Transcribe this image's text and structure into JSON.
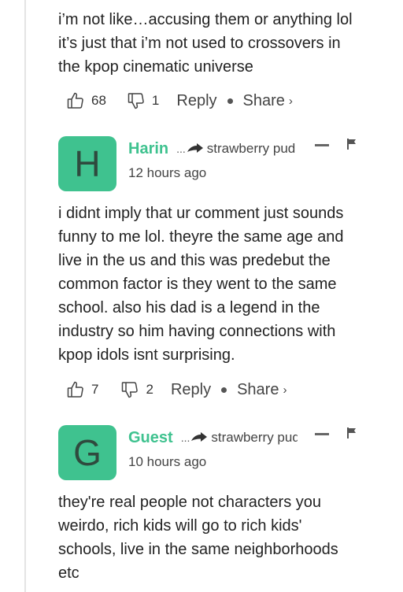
{
  "top_comment": {
    "body": [
      "i’m not like…accusing them or anything lol",
      "it’s just that i’m not used to crossovers in",
      "the kpop cinematic universe"
    ],
    "upvotes": "68",
    "downvotes": "1",
    "reply_label": "Reply",
    "share_label": "Share",
    "share_chevron": "›"
  },
  "comments": [
    {
      "avatar_letter": "H",
      "author": "Harin",
      "reply_prefix": "...",
      "reply_to": "strawberry pud",
      "timestamp": "12 hours ago",
      "body": [
        "i didnt imply that ur comment just sounds",
        "funny to me lol. theyre the same age and",
        "live in the us and this was predebut the",
        "common factor is they went to the same",
        "school. also his dad is a legend in the",
        "industry so him having connections with",
        "kpop idols isnt surprising."
      ],
      "upvotes": "7",
      "downvotes": "2",
      "reply_label": "Reply",
      "share_label": "Share",
      "share_chevron": "›"
    },
    {
      "avatar_letter": "G",
      "author": "Guest",
      "reply_prefix": "...",
      "reply_to": "strawberry pudding",
      "timestamp": "10 hours ago",
      "body": [
        "they're real people not characters you",
        "weirdo, rich kids will go to rich kids'",
        "schools, live in the same neighborhoods",
        "etc"
      ]
    }
  ],
  "colors": {
    "accent": "#3fc28f",
    "avatar_letter": "#2f4a3e",
    "text": "#222222",
    "thread_line": "#e4e4e4"
  },
  "icons": {
    "upvote": "thumbs-up-icon",
    "downvote": "thumbs-down-icon",
    "reply_arrow": "reply-arrow-icon",
    "minimize": "minimize-icon",
    "flag": "flag-icon"
  }
}
